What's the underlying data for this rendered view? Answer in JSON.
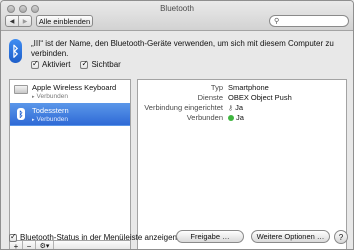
{
  "window": {
    "title": "Bluetooth"
  },
  "toolbar": {
    "show_all_label": "Alle einblenden",
    "search_value": ""
  },
  "header": {
    "description": "„III“ ist der Name, den Bluetooth-Geräte verwenden, um sich mit diesem Computer zu verbinden.",
    "activated_label": "Aktiviert",
    "activated_checked": true,
    "visible_label": "Sichtbar",
    "visible_checked": true
  },
  "devices": [
    {
      "name": "Apple Wireless Keyboard",
      "status": "Verbunden",
      "icon": "keyboard-icon",
      "selected": false
    },
    {
      "name": "Todesstern",
      "status": "Verbunden",
      "icon": "bluetooth-device-icon",
      "selected": true
    }
  ],
  "details": {
    "type_label": "Typ",
    "type_value": "Smartphone",
    "services_label": "Dienste",
    "services_value": "OBEX Object Push",
    "paired_label": "Verbindung eingerichtet",
    "paired_value": "Ja",
    "connected_label": "Verbunden",
    "connected_value": "Ja",
    "connected_color": "#3fb53f"
  },
  "footer": {
    "menubar_label": "Bluetooth-Status in der Menüleiste anzeigen",
    "menubar_checked": true,
    "pair_button": "Freigabe …",
    "advanced_button": "Weitere Optionen …",
    "help_label": "?"
  },
  "list_buttons": {
    "add": "+",
    "remove": "−",
    "gear": "⚙▾"
  },
  "colors": {
    "selection": "#3b7be0",
    "bluetooth_blue": "#2a6fe0"
  }
}
